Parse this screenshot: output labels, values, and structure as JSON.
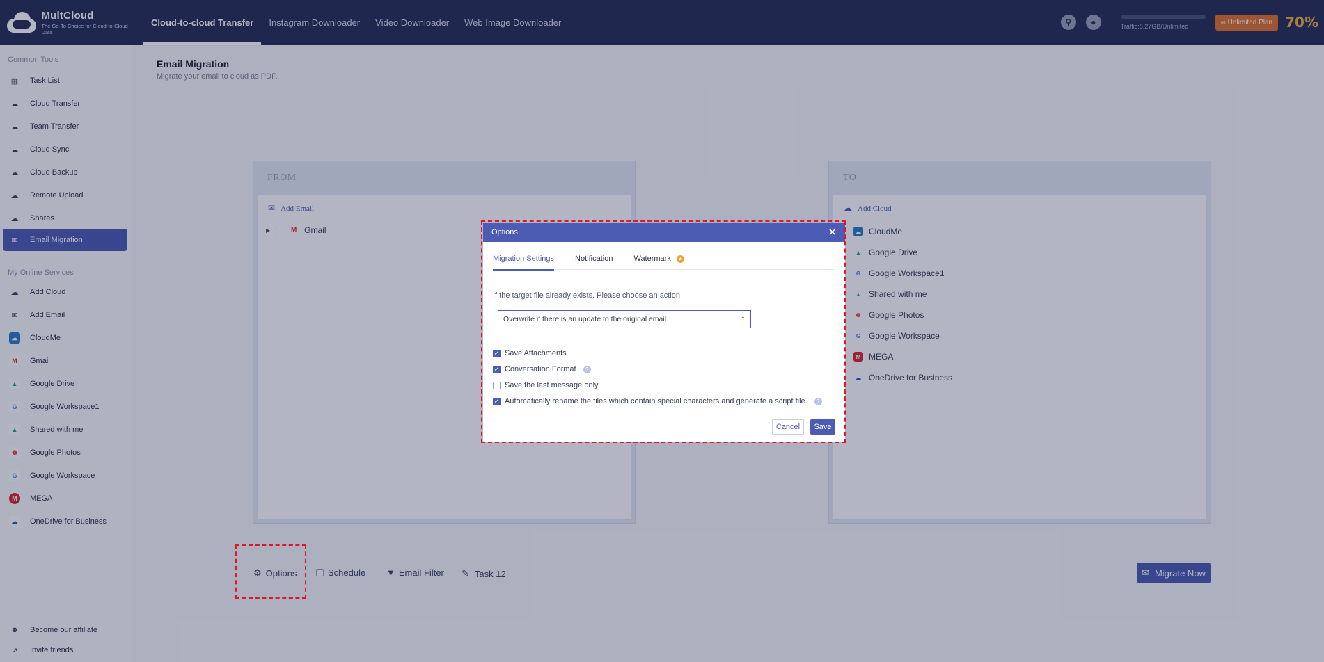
{
  "app": {
    "name": "MultCloud",
    "tagline": "The Go-To Choice for Cloud-to-Cloud Data",
    "nav": [
      "Cloud-to-cloud Transfer",
      "Instagram Downloader",
      "Video Downloader",
      "Web Image Downloader"
    ],
    "traffic": "Traffic:8.27GB/Unlimited",
    "plan_button": "Unlimited Plan",
    "promo": "70%"
  },
  "sidebar": {
    "common_heading": "Common Tools",
    "common": [
      {
        "label": "Task List",
        "icon": "grid-icon"
      },
      {
        "label": "Cloud Transfer",
        "icon": "cloud-transfer-icon"
      },
      {
        "label": "Team Transfer",
        "icon": "team-transfer-icon"
      },
      {
        "label": "Cloud Sync",
        "icon": "cloud-sync-icon"
      },
      {
        "label": "Cloud Backup",
        "icon": "cloud-backup-icon"
      },
      {
        "label": "Remote Upload",
        "icon": "remote-upload-icon"
      },
      {
        "label": "Shares",
        "icon": "share-icon"
      },
      {
        "label": "Email Migration",
        "icon": "email-migration-icon"
      }
    ],
    "services_heading": "My Online Services",
    "services": [
      {
        "label": "Add Cloud",
        "icon": "add-cloud-icon"
      },
      {
        "label": "Add Email",
        "icon": "add-email-icon"
      },
      {
        "label": "CloudMe",
        "icon": "cloudme-icon"
      },
      {
        "label": "Gmail",
        "icon": "gmail-icon"
      },
      {
        "label": "Google Drive",
        "icon": "google-drive-icon"
      },
      {
        "label": "Google Workspace1",
        "icon": "google-icon"
      },
      {
        "label": "Shared with me",
        "icon": "google-drive-icon"
      },
      {
        "label": "Google Photos",
        "icon": "google-photos-icon"
      },
      {
        "label": "Google Workspace",
        "icon": "google-icon"
      },
      {
        "label": "MEGA",
        "icon": "mega-icon"
      },
      {
        "label": "OneDrive for Business",
        "icon": "onedrive-icon"
      }
    ],
    "footer": [
      {
        "label": "Become our affiliate",
        "icon": "affiliate-icon"
      },
      {
        "label": "Invite friends",
        "icon": "share-link-icon"
      }
    ]
  },
  "page": {
    "title": "Email Migration",
    "subtitle": "Migrate your email to cloud as PDF."
  },
  "from_panel": {
    "heading": "FROM",
    "add_label": "Add Email",
    "items": [
      "Gmail"
    ]
  },
  "to_panel": {
    "heading": "TO",
    "add_label": "Add Cloud",
    "items": [
      "CloudMe",
      "Google Drive",
      "Google Workspace1",
      "Shared with me",
      "Google Photos",
      "Google Workspace",
      "MEGA",
      "OneDrive for Business"
    ]
  },
  "bottom": {
    "options": "Options",
    "schedule": "Schedule",
    "email_filter": "Email Filter",
    "task": "Task 12",
    "migrate_now": "Migrate Now"
  },
  "dialog": {
    "title": "Options",
    "tabs": [
      "Migration Settings",
      "Notification",
      "Watermark"
    ],
    "prompt": "If the target file already exists. Please choose an action:",
    "select_value": "Overwrite if there is an update to the original email.",
    "checks": [
      {
        "label": "Save Attachments",
        "checked": true
      },
      {
        "label": "Conversation Format",
        "checked": true
      },
      {
        "label": "Save the last message only",
        "checked": false
      },
      {
        "label": "Automatically rename the files which contain special characters and generate a script file.",
        "checked": true
      }
    ],
    "cancel": "Cancel",
    "save": "Save"
  },
  "colors": {
    "accent": "#4c5bb3",
    "topbar": "#262d56",
    "highlight": "#e0142b",
    "plan": "#e0702b"
  }
}
